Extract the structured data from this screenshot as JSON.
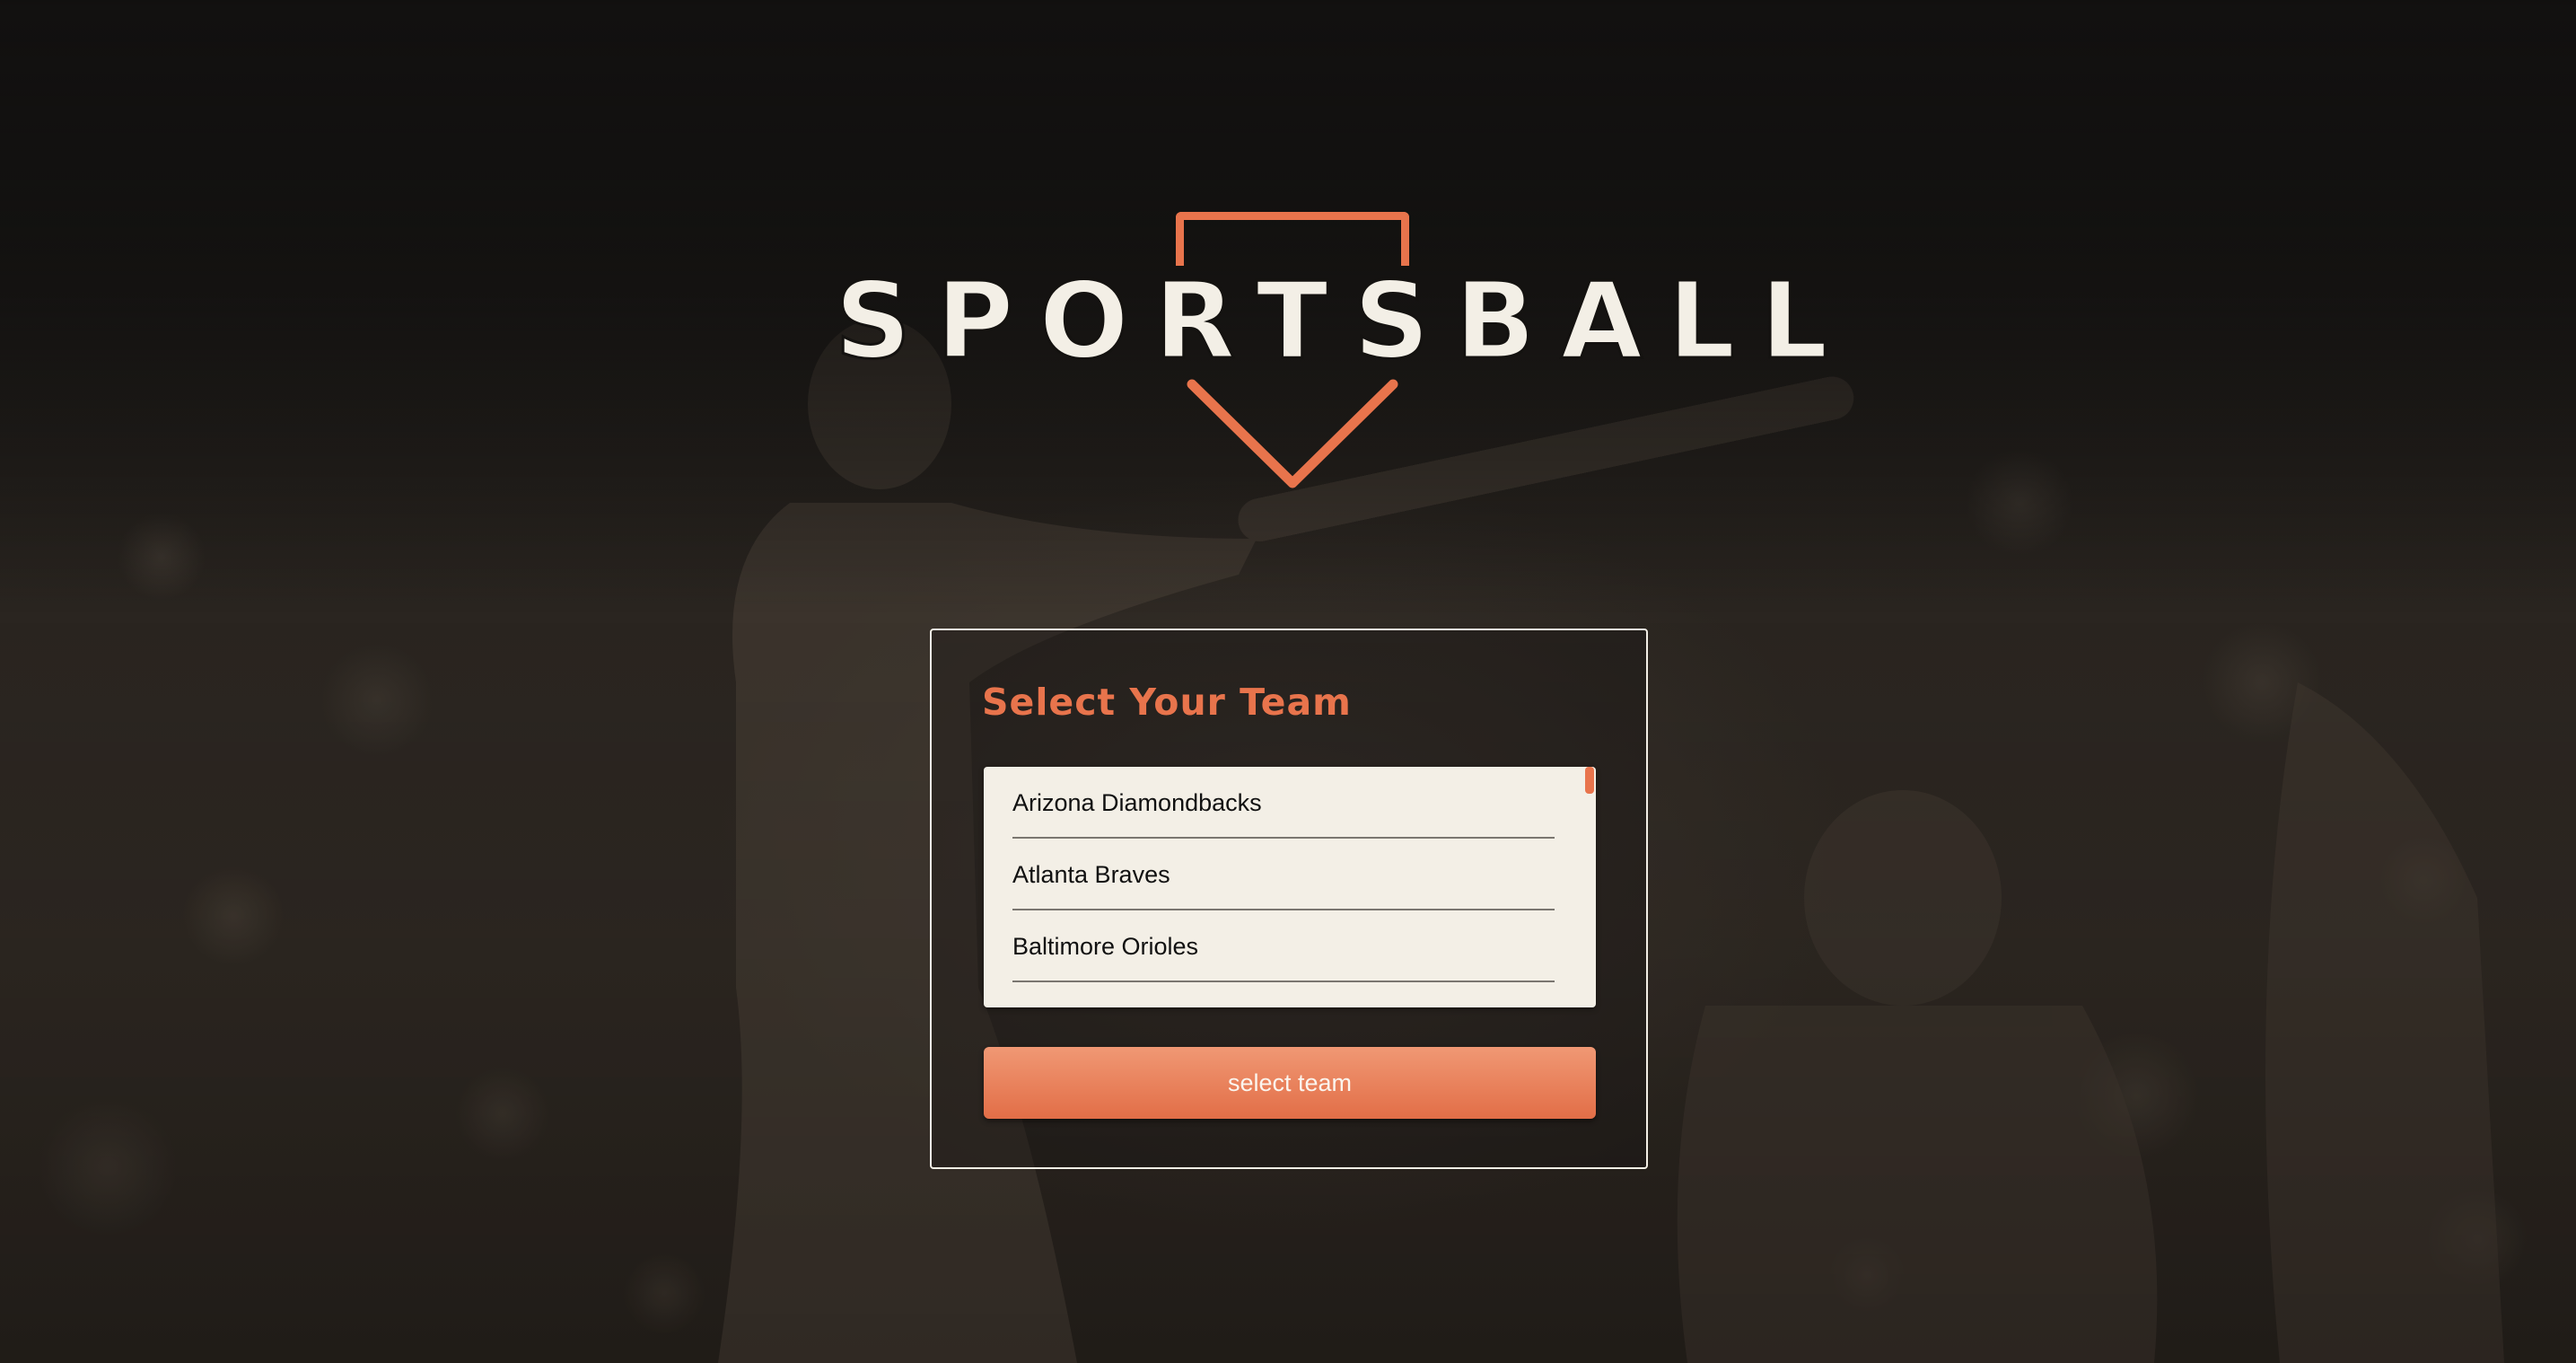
{
  "logo": {
    "text": "SPORTSBALL",
    "accent_color": "#e8744c",
    "text_color": "#f3efe6"
  },
  "team_picker": {
    "title": "Select Your Team",
    "teams": [
      "Arizona Diamondbacks",
      "Atlanta Braves",
      "Baltimore Orioles"
    ],
    "button_label": "select team"
  },
  "colors": {
    "accent": "#e8744c",
    "list_background": "#f3efe6",
    "page_background": "#141210"
  },
  "icons": {
    "home_plate": "home-plate-icon",
    "down_chevron": "chevron-down-icon"
  }
}
